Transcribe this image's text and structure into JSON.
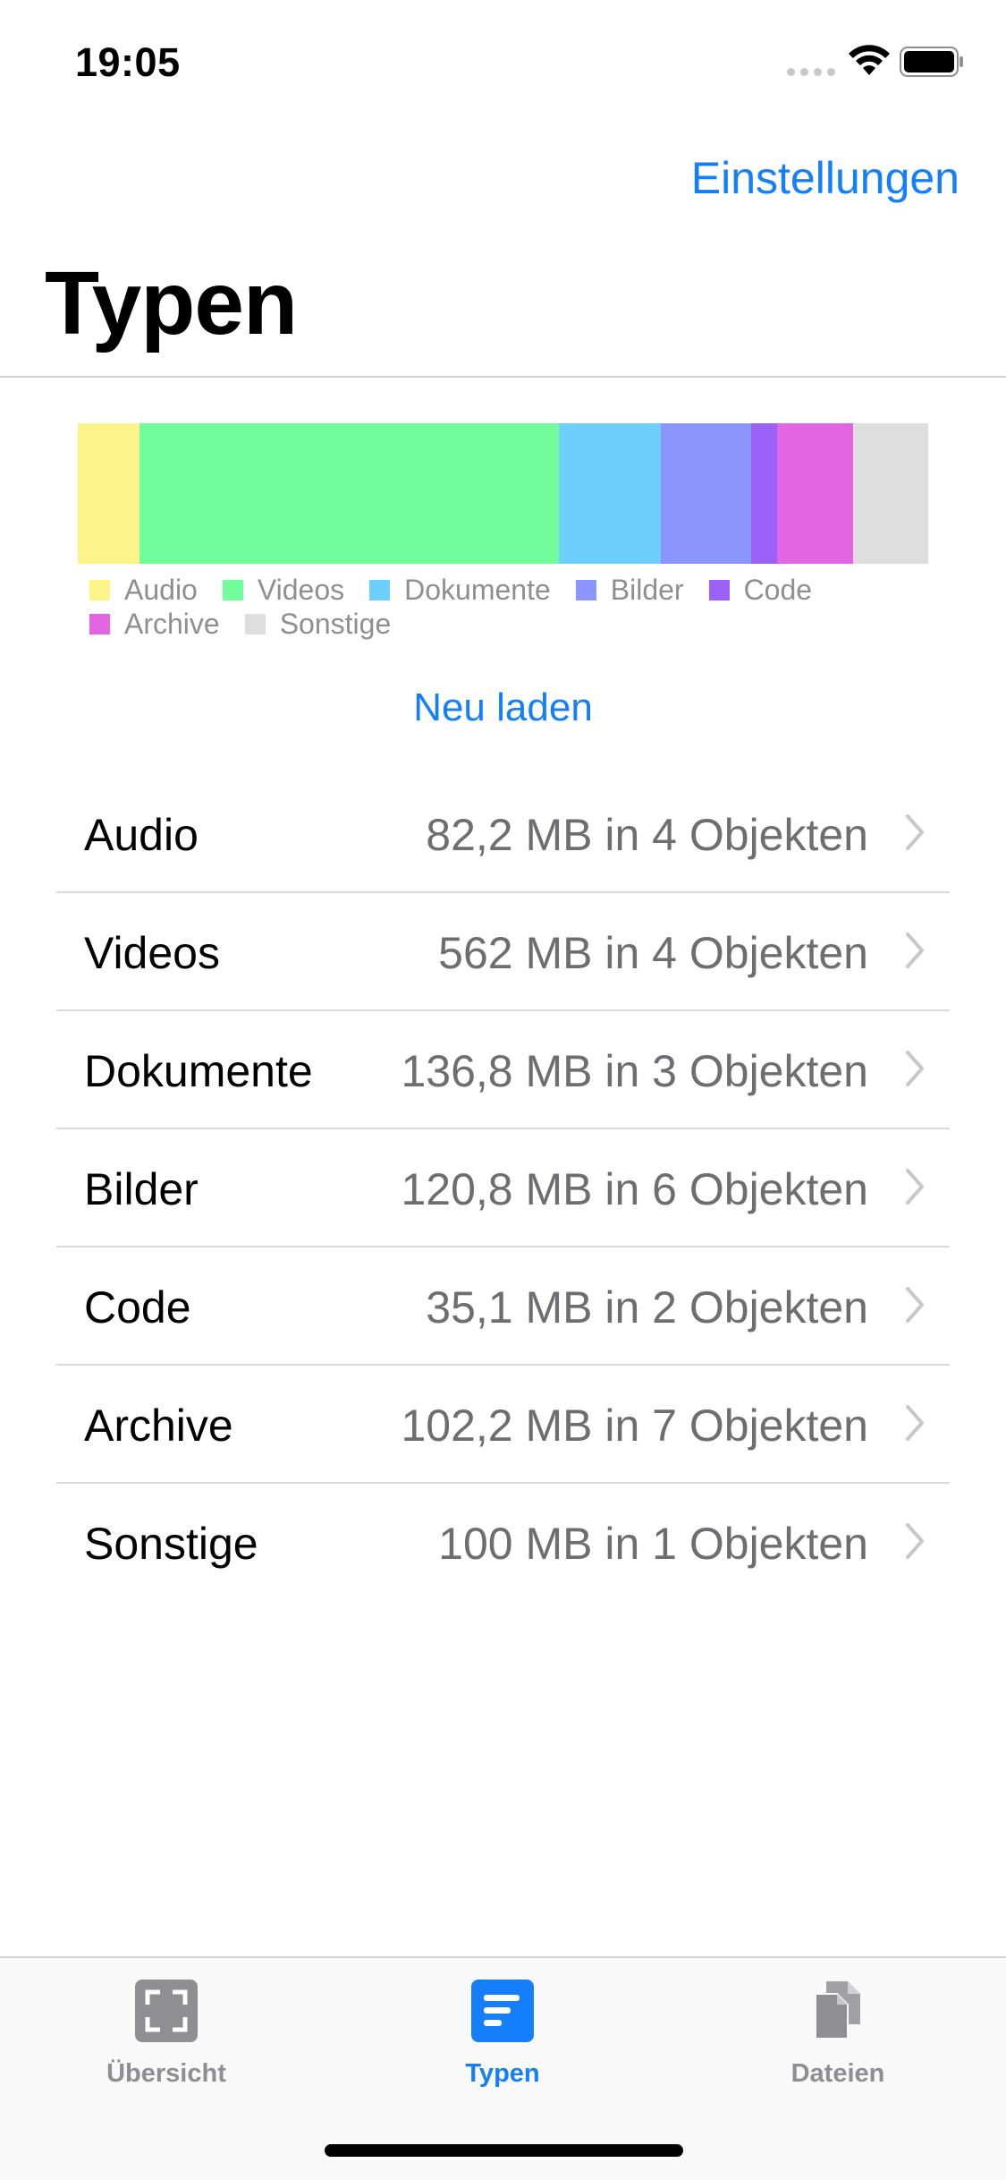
{
  "status_bar": {
    "time": "19:05"
  },
  "nav": {
    "settings_label": "Einstellungen",
    "title": "Typen"
  },
  "chart_data": {
    "type": "bar",
    "orientation": "stacked-horizontal",
    "categories": [
      "Audio",
      "Videos",
      "Dokumente",
      "Bilder",
      "Code",
      "Archive",
      "Sonstige"
    ],
    "values": [
      82.2,
      562,
      136.8,
      120.8,
      35.1,
      102.2,
      100
    ],
    "unit": "MB",
    "colors": [
      "#fcf488",
      "#73fc9c",
      "#6fcffc",
      "#8a96fb",
      "#9c62f8",
      "#e266e2",
      "#dedede"
    ],
    "legend": {
      "visible": true,
      "placement": "bottom"
    }
  },
  "reload_label": "Neu laden",
  "list": [
    {
      "label": "Audio",
      "value": "82,2 MB in 4 Objekten"
    },
    {
      "label": "Videos",
      "value": "562 MB in 4 Objekten"
    },
    {
      "label": "Dokumente",
      "value": "136,8 MB in 3 Objekten"
    },
    {
      "label": "Bilder",
      "value": "120,8 MB in 6 Objekten"
    },
    {
      "label": "Code",
      "value": "35,1 MB in 2 Objekten"
    },
    {
      "label": "Archive",
      "value": "102,2 MB in 7 Objekten"
    },
    {
      "label": "Sonstige",
      "value": "100 MB in 1 Objekten"
    }
  ],
  "tabbar": {
    "tabs": [
      {
        "label": "Übersicht",
        "icon": "overview-icon",
        "active": false
      },
      {
        "label": "Typen",
        "icon": "types-icon",
        "active": true
      },
      {
        "label": "Dateien",
        "icon": "files-icon",
        "active": false
      }
    ],
    "active_color": "#147efb",
    "inactive_color": "#8e8e93"
  }
}
